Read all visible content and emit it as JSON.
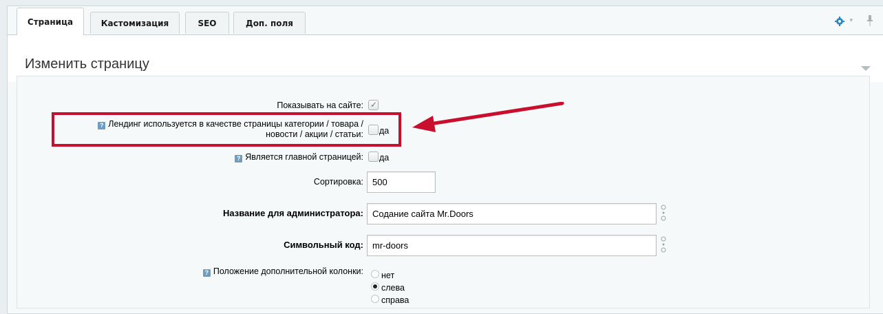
{
  "tabs": [
    {
      "label": "Страница",
      "active": true
    },
    {
      "label": "Кастомизация",
      "active": false
    },
    {
      "label": "SEO",
      "active": false
    },
    {
      "label": "Доп. поля",
      "active": false
    }
  ],
  "header": {
    "title": "Изменить страницу"
  },
  "form": {
    "show_on_site": {
      "label": "Показывать на сайте:",
      "checked": true
    },
    "landing_category": {
      "label_line1": "Лендинг используется в качестве страницы категории / товара /",
      "label_line2": "новости / акции / статьи:",
      "option": "да",
      "checked": false
    },
    "is_main": {
      "label": "Является главной страницей:",
      "option": "да",
      "checked": false
    },
    "sort": {
      "label": "Сортировка:",
      "value": "500"
    },
    "admin_name": {
      "label": "Название для администратора:",
      "value": "Содание сайта Mr.Doors"
    },
    "code": {
      "label": "Символьный код:",
      "value": "mr-doors"
    },
    "column_position": {
      "label": "Положение дополнительной колонки:",
      "options": [
        "нет",
        "слева",
        "справа"
      ],
      "selected": "слева"
    }
  },
  "help_glyph": "?",
  "colors": {
    "accent": "#c8102e",
    "gear": "#2a87c6"
  }
}
